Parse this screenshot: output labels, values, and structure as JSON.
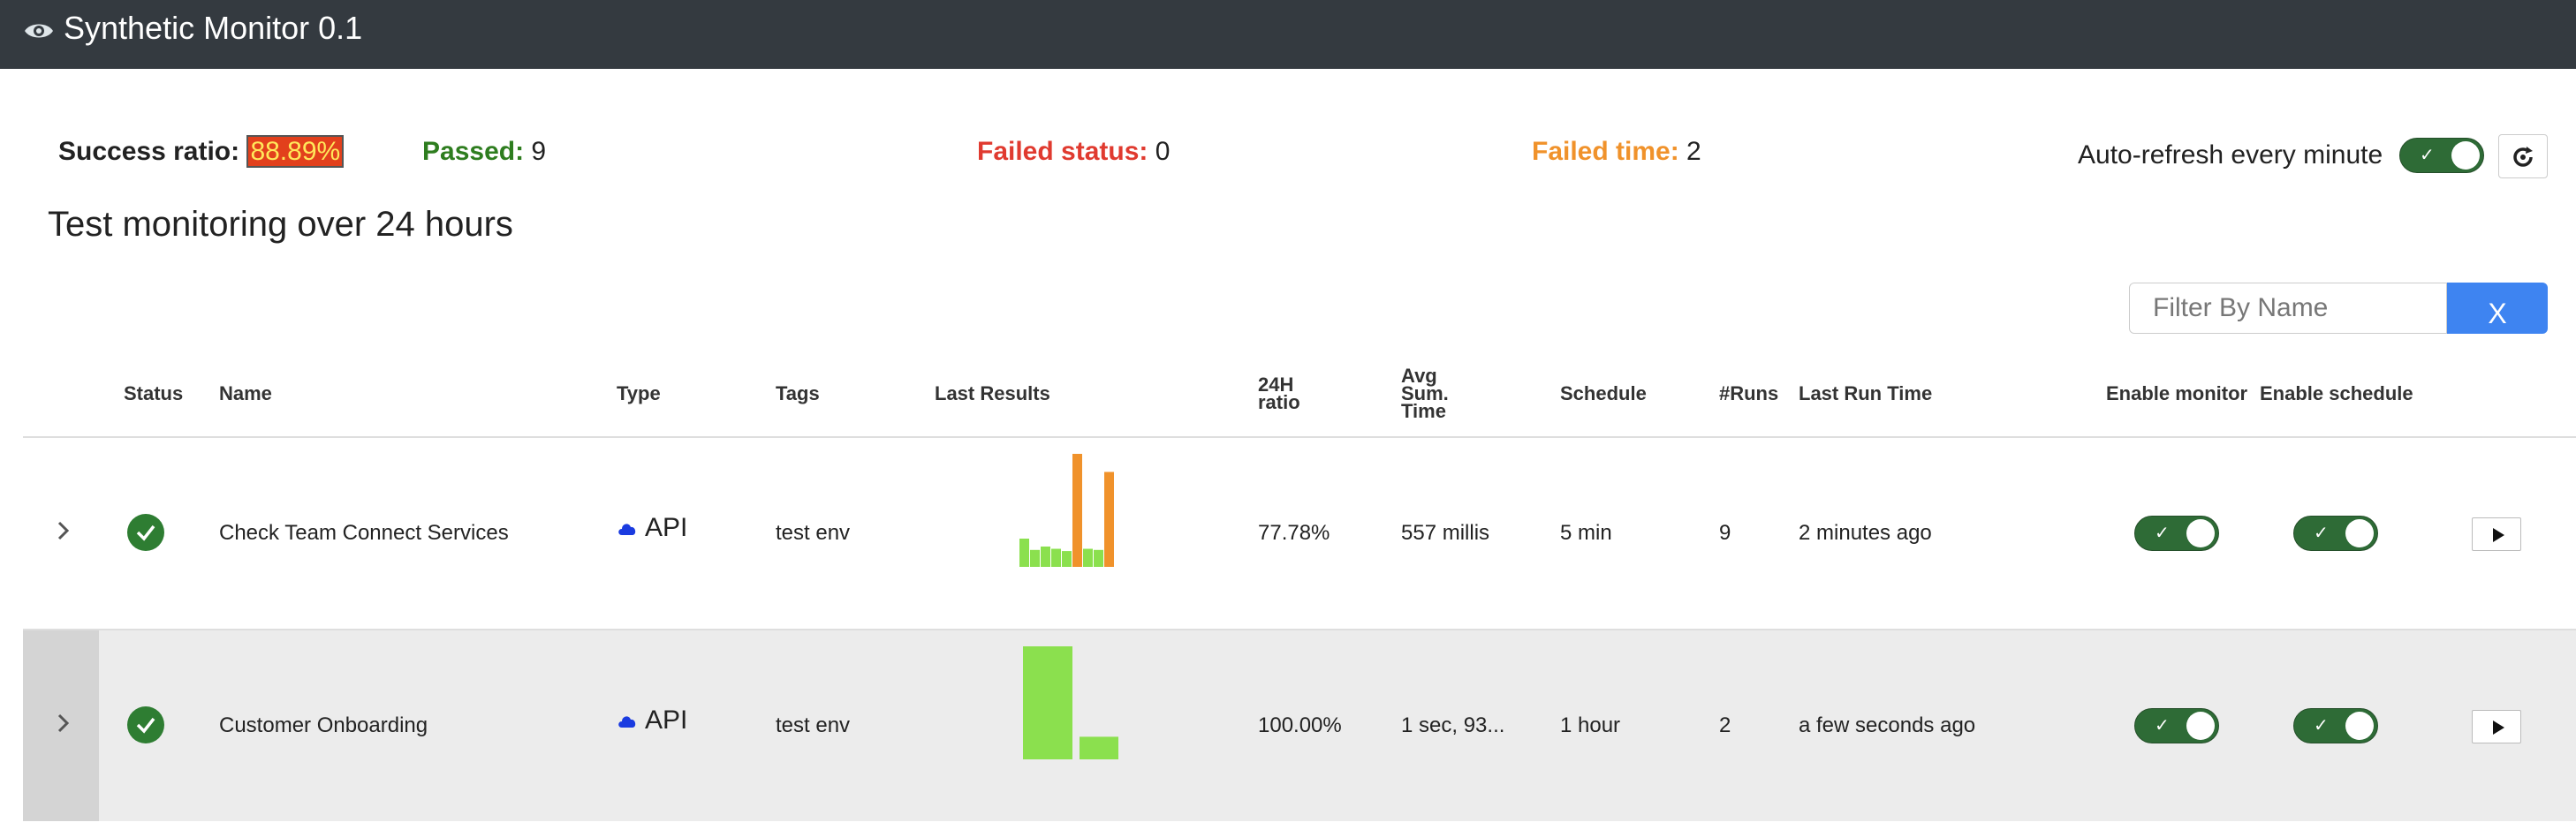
{
  "app": {
    "title": "Synthetic Monitor 0.1",
    "icon": "eye-icon"
  },
  "stats": {
    "success_label": "Success ratio:",
    "success_value": "88.89%",
    "passed_label": "Passed:",
    "passed_value": "9",
    "failed_status_label": "Failed status:",
    "failed_status_value": "0",
    "failed_time_label": "Failed time:",
    "failed_time_value": "2",
    "colors": {
      "passed": "#2e7d1f",
      "failed_status": "#e03a2f",
      "failed_time": "#f0922b",
      "ratio_bg": "#e2401c",
      "ratio_text": "#ffe75a"
    }
  },
  "auto_refresh": {
    "label": "Auto-refresh every minute",
    "enabled": true,
    "refresh_icon": "refresh-icon"
  },
  "subtitle": "Test monitoring over 24 hours",
  "filter": {
    "placeholder": "Filter By Name",
    "value": "",
    "clear_label": "X"
  },
  "table": {
    "headers": {
      "status": "Status",
      "name": "Name",
      "type": "Type",
      "tags": "Tags",
      "last_results": "Last Results",
      "ratio_line1": "24H",
      "ratio_line2": "ratio",
      "avg_line1": "Avg",
      "avg_line2": "Sum.",
      "avg_line3": "Time",
      "schedule": "Schedule",
      "runs": "#Runs",
      "last_run": "Last Run Time",
      "enable_monitor": "Enable monitor",
      "enable_schedule": "Enable schedule"
    },
    "rows": [
      {
        "status": "success",
        "name": "Check Team Connect Services",
        "type": "API",
        "tags": "test env",
        "ratio": "77.78%",
        "avg_time": "557 millis",
        "schedule": "5 min",
        "runs": "9",
        "last_run": "2 minutes ago",
        "enable_monitor": true,
        "enable_schedule": true,
        "last_results": [
          {
            "value": 0.25,
            "status": "passed"
          },
          {
            "value": 0.15,
            "status": "passed"
          },
          {
            "value": 0.18,
            "status": "passed"
          },
          {
            "value": 0.16,
            "status": "passed"
          },
          {
            "value": 0.14,
            "status": "passed"
          },
          {
            "value": 1.0,
            "status": "failed_time"
          },
          {
            "value": 0.16,
            "status": "passed"
          },
          {
            "value": 0.15,
            "status": "passed"
          },
          {
            "value": 0.84,
            "status": "failed_time"
          }
        ]
      },
      {
        "status": "success",
        "name": "Customer Onboarding",
        "type": "API",
        "tags": "test env",
        "ratio": "100.00%",
        "avg_time": "1 sec, 93...",
        "schedule": "1 hour",
        "runs": "2",
        "last_run": "a few seconds ago",
        "enable_monitor": true,
        "enable_schedule": true,
        "last_results": [
          {
            "value": 1.0,
            "status": "passed"
          },
          {
            "value": 0.2,
            "status": "passed"
          }
        ]
      }
    ],
    "bar_colors": {
      "passed": "#8be04e",
      "failed_time": "#f0922b"
    }
  }
}
